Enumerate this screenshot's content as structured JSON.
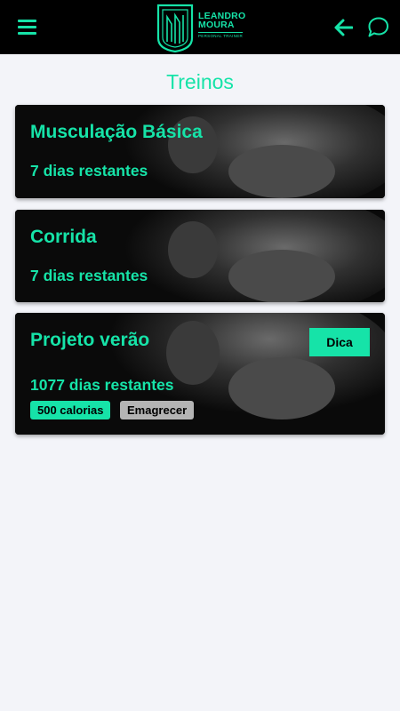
{
  "app": {
    "logo": {
      "name_line1": "LEANDRO",
      "name_line2": "MOURA",
      "subtitle": "PERSONAL TRAINER"
    },
    "icons": {
      "menu": "hamburger-menu-icon",
      "back": "arrow-left-icon",
      "chat": "chat-bubble-icon"
    },
    "colors": {
      "accent": "#16e3a8",
      "topbar": "#000000",
      "background": "#f3f4f9",
      "card": "#0a0a0a",
      "tag_secondary": "#b4b4b4"
    }
  },
  "page": {
    "title": "Treinos"
  },
  "workouts": [
    {
      "title": "Musculação Básica",
      "days_left": "7 dias restantes"
    },
    {
      "title": "Corrida",
      "days_left": "7 dias restantes"
    },
    {
      "title": "Projeto verão",
      "days_left": "1077 dias restantes",
      "tip_label": "Dica",
      "tags": [
        "500 calorias",
        "Emagrecer"
      ]
    }
  ]
}
